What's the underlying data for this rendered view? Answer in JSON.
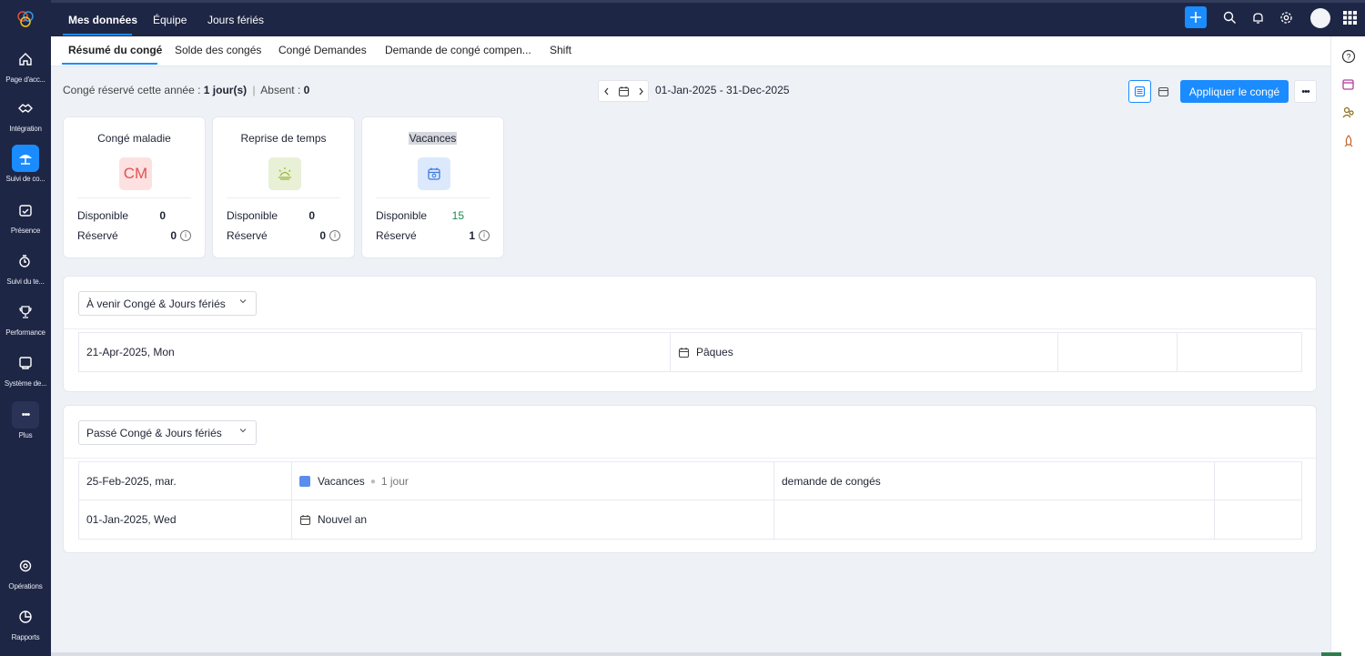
{
  "sidebar": {
    "items": [
      {
        "label": "Page d'acc...",
        "icon": "home-icon"
      },
      {
        "label": "Intégration",
        "icon": "handshake-icon"
      },
      {
        "label": "Suivi de co...",
        "icon": "umbrella-icon",
        "active": true
      },
      {
        "label": "Présence",
        "icon": "calendar-check-icon"
      },
      {
        "label": "Suivi du te...",
        "icon": "timer-icon"
      },
      {
        "label": "Performance",
        "icon": "trophy-icon"
      },
      {
        "label": "Système de...",
        "icon": "system-icon"
      },
      {
        "label": "Plus",
        "icon": "more-icon"
      },
      {
        "label": "Opérations",
        "icon": "operations-icon"
      },
      {
        "label": "Rapports",
        "icon": "report-icon"
      }
    ]
  },
  "topnav": {
    "tabs": [
      {
        "label": "Mes données",
        "active": true
      },
      {
        "label": "Équipe"
      },
      {
        "label": "Jours fériés"
      }
    ]
  },
  "subtabs": [
    {
      "label": "Résumé du congé",
      "active": true
    },
    {
      "label": "Solde des congés"
    },
    {
      "label": "Congé Demandes"
    },
    {
      "label": "Demande de congé compen..."
    },
    {
      "label": "Shift"
    }
  ],
  "toolbar": {
    "booked_label": "Congé réservé cette année :",
    "booked_value": "1 jour(s)",
    "separator": "|",
    "absent_label": "Absent :",
    "absent_value": "0",
    "date_range": "01-Jan-2025 - 31-Dec-2025",
    "apply_label": "Appliquer le congé",
    "more_label": "•••"
  },
  "cards": [
    {
      "title": "Congé maladie",
      "badge": "CM",
      "icon": "cm-badge",
      "available_label": "Disponible",
      "available": "0",
      "booked_label": "Réservé",
      "booked": "0"
    },
    {
      "title": "Reprise de temps",
      "icon": "sunrise-icon",
      "available_label": "Disponible",
      "available": "0",
      "booked_label": "Réservé",
      "booked": "0"
    },
    {
      "title": "Vacances",
      "icon": "calendar-icon",
      "available_label": "Disponible",
      "available": "15",
      "booked_label": "Réservé",
      "booked": "1"
    }
  ],
  "upcoming": {
    "dropdown": "À venir Congé & Jours fériés",
    "rows": [
      {
        "date": "21-Apr-2025, Mon",
        "name": "Pâques"
      }
    ]
  },
  "past": {
    "dropdown": "Passé Congé & Jours fériés",
    "rows": [
      {
        "date": "25-Feb-2025, mar.",
        "name": "Vacances",
        "duration": "1 jour",
        "type": "demande de congés"
      },
      {
        "date": "01-Jan-2025, Wed",
        "name": "Nouvel an",
        "duration": "",
        "type": ""
      }
    ]
  },
  "colors": {
    "sidebar_bg": "#1e2645",
    "accent": "#1a8cff",
    "cm_badge_bg": "#fde1e1",
    "cm_badge_fg": "#e2534f",
    "green": "#1b8a4d"
  }
}
